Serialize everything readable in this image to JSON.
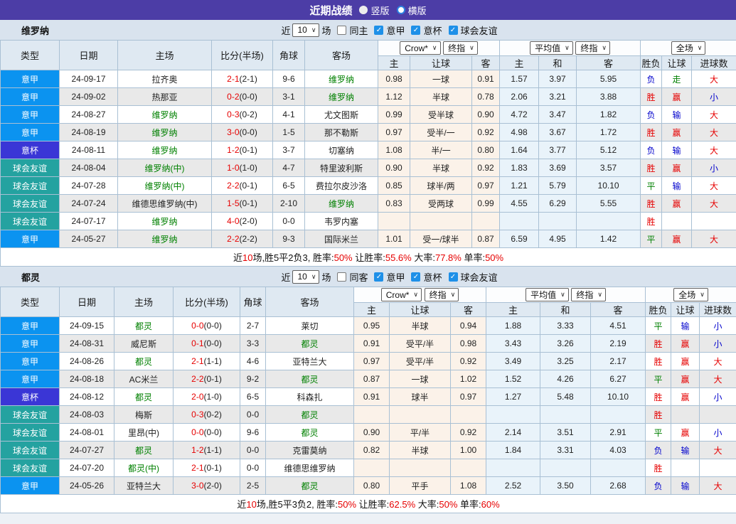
{
  "title_bar": {
    "title": "近期战绩",
    "radio_vertical": "竖版",
    "radio_horizontal": "横版"
  },
  "filters_common": {
    "near_label": "近",
    "matches_count": "10",
    "matches_label": "场",
    "league_seriea": "意甲",
    "league_cup": "意杯",
    "league_friendly": "球会友谊"
  },
  "columns": {
    "type": "类型",
    "date": "日期",
    "home": "主场",
    "score": "比分(半场)",
    "corner": "角球",
    "away": "客场",
    "odds_home": "主",
    "odds_handicap": "让球",
    "odds_away": "客",
    "avg_home": "主",
    "avg_draw": "和",
    "avg_away": "客",
    "result_wl": "胜负",
    "result_handicap": "让球",
    "result_goals": "进球数",
    "bookmaker": "Crow*",
    "final_odds": "终指",
    "average": "平均值",
    "full_match": "全场"
  },
  "sections": [
    {
      "team": "维罗纳",
      "same_filter_label": "同主",
      "rows": [
        {
          "type": "意甲",
          "type_key": "seriea",
          "date": "24-09-17",
          "home": "拉齐奥",
          "home_hl": false,
          "score_ft": "2-1",
          "score_ht": "(2-1)",
          "corner": "9-6",
          "away": "维罗纳",
          "away_hl": true,
          "o1": "0.98",
          "hc": "一球",
          "o2": "0.91",
          "a1": "1.57",
          "a2": "3.97",
          "a3": "5.95",
          "r1": "负",
          "r2": "走",
          "r3": "大"
        },
        {
          "type": "意甲",
          "type_key": "seriea",
          "date": "24-09-02",
          "home": "热那亚",
          "home_hl": false,
          "score_ft": "0-2",
          "score_ht": "(0-0)",
          "corner": "3-1",
          "away": "维罗纳",
          "away_hl": true,
          "o1": "1.12",
          "hc": "半球",
          "o2": "0.78",
          "a1": "2.06",
          "a2": "3.21",
          "a3": "3.88",
          "r1": "胜",
          "r2": "赢",
          "r3": "小"
        },
        {
          "type": "意甲",
          "type_key": "seriea",
          "date": "24-08-27",
          "home": "维罗纳",
          "home_hl": true,
          "score_ft": "0-3",
          "score_ht": "(0-2)",
          "corner": "4-1",
          "away": "尤文图斯",
          "away_hl": false,
          "o1": "0.99",
          "hc": "受半球",
          "o2": "0.90",
          "a1": "4.72",
          "a2": "3.47",
          "a3": "1.82",
          "r1": "负",
          "r2": "输",
          "r3": "大"
        },
        {
          "type": "意甲",
          "type_key": "seriea",
          "date": "24-08-19",
          "home": "维罗纳",
          "home_hl": true,
          "score_ft": "3-0",
          "score_ht": "(0-0)",
          "corner": "1-5",
          "away": "那不勒斯",
          "away_hl": false,
          "o1": "0.97",
          "hc": "受半/一",
          "o2": "0.92",
          "a1": "4.98",
          "a2": "3.67",
          "a3": "1.72",
          "r1": "胜",
          "r2": "赢",
          "r3": "大"
        },
        {
          "type": "意杯",
          "type_key": "cup",
          "date": "24-08-11",
          "home": "维罗纳",
          "home_hl": true,
          "score_ft": "1-2",
          "score_ht": "(0-1)",
          "corner": "3-7",
          "away": "切塞纳",
          "away_hl": false,
          "o1": "1.08",
          "hc": "半/一",
          "o2": "0.80",
          "a1": "1.64",
          "a2": "3.77",
          "a3": "5.12",
          "r1": "负",
          "r2": "输",
          "r3": "大"
        },
        {
          "type": "球会友谊",
          "type_key": "friendly",
          "date": "24-08-04",
          "home": "维罗纳(中)",
          "home_hl": true,
          "score_ft": "1-0",
          "score_ht": "(1-0)",
          "corner": "4-7",
          "away": "特里波利斯",
          "away_hl": false,
          "o1": "0.90",
          "hc": "半球",
          "o2": "0.92",
          "a1": "1.83",
          "a2": "3.69",
          "a3": "3.57",
          "r1": "胜",
          "r2": "赢",
          "r3": "小"
        },
        {
          "type": "球会友谊",
          "type_key": "friendly",
          "date": "24-07-28",
          "home": "维罗纳(中)",
          "home_hl": true,
          "score_ft": "2-2",
          "score_ht": "(0-1)",
          "corner": "6-5",
          "away": "费拉尔皮沙洛",
          "away_hl": false,
          "o1": "0.85",
          "hc": "球半/两",
          "o2": "0.97",
          "a1": "1.21",
          "a2": "5.79",
          "a3": "10.10",
          "r1": "平",
          "r2": "输",
          "r3": "大"
        },
        {
          "type": "球会友谊",
          "type_key": "friendly",
          "date": "24-07-24",
          "home": "维德思维罗纳(中)",
          "home_hl": false,
          "score_ft": "1-5",
          "score_ht": "(0-1)",
          "corner": "2-10",
          "away": "维罗纳",
          "away_hl": true,
          "o1": "0.83",
          "hc": "受两球",
          "o2": "0.99",
          "a1": "4.55",
          "a2": "6.29",
          "a3": "5.55",
          "r1": "胜",
          "r2": "赢",
          "r3": "大"
        },
        {
          "type": "球会友谊",
          "type_key": "friendly",
          "date": "24-07-17",
          "home": "维罗纳",
          "home_hl": true,
          "score_ft": "4-0",
          "score_ht": "(2-0)",
          "corner": "0-0",
          "away": "韦罗内塞",
          "away_hl": false,
          "o1": "",
          "hc": "",
          "o2": "",
          "a1": "",
          "a2": "",
          "a3": "",
          "r1": "胜",
          "r2": "",
          "r3": ""
        },
        {
          "type": "意甲",
          "type_key": "seriea",
          "date": "24-05-27",
          "home": "维罗纳",
          "home_hl": true,
          "score_ft": "2-2",
          "score_ht": "(2-2)",
          "corner": "9-3",
          "away": "国际米兰",
          "away_hl": false,
          "o1": "1.01",
          "hc": "受一/球半",
          "o2": "0.87",
          "a1": "6.59",
          "a2": "4.95",
          "a3": "1.42",
          "r1": "平",
          "r2": "赢",
          "r3": "大"
        }
      ],
      "summary_segments": [
        [
          "近",
          "k"
        ],
        [
          "10",
          "r"
        ],
        [
          "场,胜5平2负3, ",
          "k"
        ],
        [
          "胜率:",
          "k"
        ],
        [
          "50%",
          "r"
        ],
        [
          " 让胜率:",
          "k"
        ],
        [
          "55.6%",
          "r"
        ],
        [
          " 大率:",
          "k"
        ],
        [
          "77.8%",
          "r"
        ],
        [
          " 单率:",
          "k"
        ],
        [
          "50%",
          "r"
        ]
      ]
    },
    {
      "team": "都灵",
      "same_filter_label": "同客",
      "rows": [
        {
          "type": "意甲",
          "type_key": "seriea",
          "date": "24-09-15",
          "home": "都灵",
          "home_hl": true,
          "score_ft": "0-0",
          "score_ht": "(0-0)",
          "corner": "2-7",
          "away": "莱切",
          "away_hl": false,
          "o1": "0.95",
          "hc": "半球",
          "o2": "0.94",
          "a1": "1.88",
          "a2": "3.33",
          "a3": "4.51",
          "r1": "平",
          "r2": "输",
          "r3": "小"
        },
        {
          "type": "意甲",
          "type_key": "seriea",
          "date": "24-08-31",
          "home": "威尼斯",
          "home_hl": false,
          "score_ft": "0-1",
          "score_ht": "(0-0)",
          "corner": "3-3",
          "away": "都灵",
          "away_hl": true,
          "o1": "0.91",
          "hc": "受平/半",
          "o2": "0.98",
          "a1": "3.43",
          "a2": "3.26",
          "a3": "2.19",
          "r1": "胜",
          "r2": "赢",
          "r3": "小"
        },
        {
          "type": "意甲",
          "type_key": "seriea",
          "date": "24-08-26",
          "home": "都灵",
          "home_hl": true,
          "score_ft": "2-1",
          "score_ht": "(1-1)",
          "corner": "4-6",
          "away": "亚特兰大",
          "away_hl": false,
          "o1": "0.97",
          "hc": "受平/半",
          "o2": "0.92",
          "a1": "3.49",
          "a2": "3.25",
          "a3": "2.17",
          "r1": "胜",
          "r2": "赢",
          "r3": "大"
        },
        {
          "type": "意甲",
          "type_key": "seriea",
          "date": "24-08-18",
          "home": "AC米兰",
          "home_hl": false,
          "score_ft": "2-2",
          "score_ht": "(0-1)",
          "corner": "9-2",
          "away": "都灵",
          "away_hl": true,
          "o1": "0.87",
          "hc": "一球",
          "o2": "1.02",
          "a1": "1.52",
          "a2": "4.26",
          "a3": "6.27",
          "r1": "平",
          "r2": "赢",
          "r3": "大"
        },
        {
          "type": "意杯",
          "type_key": "cup",
          "date": "24-08-12",
          "home": "都灵",
          "home_hl": true,
          "score_ft": "2-0",
          "score_ht": "(1-0)",
          "corner": "6-5",
          "away": "科森扎",
          "away_hl": false,
          "o1": "0.91",
          "hc": "球半",
          "o2": "0.97",
          "a1": "1.27",
          "a2": "5.48",
          "a3": "10.10",
          "r1": "胜",
          "r2": "赢",
          "r3": "小"
        },
        {
          "type": "球会友谊",
          "type_key": "friendly",
          "date": "24-08-03",
          "home": "梅斯",
          "home_hl": false,
          "score_ft": "0-3",
          "score_ht": "(0-2)",
          "corner": "0-0",
          "away": "都灵",
          "away_hl": true,
          "o1": "",
          "hc": "",
          "o2": "",
          "a1": "",
          "a2": "",
          "a3": "",
          "r1": "胜",
          "r2": "",
          "r3": ""
        },
        {
          "type": "球会友谊",
          "type_key": "friendly",
          "date": "24-08-01",
          "home": "里昂(中)",
          "home_hl": false,
          "score_ft": "0-0",
          "score_ht": "(0-0)",
          "corner": "9-6",
          "away": "都灵",
          "away_hl": true,
          "o1": "0.90",
          "hc": "平/半",
          "o2": "0.92",
          "a1": "2.14",
          "a2": "3.51",
          "a3": "2.91",
          "r1": "平",
          "r2": "赢",
          "r3": "小"
        },
        {
          "type": "球会友谊",
          "type_key": "friendly",
          "date": "24-07-27",
          "home": "都灵",
          "home_hl": true,
          "score_ft": "1-2",
          "score_ht": "(1-1)",
          "corner": "0-0",
          "away": "克雷莫纳",
          "away_hl": false,
          "o1": "0.82",
          "hc": "半球",
          "o2": "1.00",
          "a1": "1.84",
          "a2": "3.31",
          "a3": "4.03",
          "r1": "负",
          "r2": "输",
          "r3": "大"
        },
        {
          "type": "球会友谊",
          "type_key": "friendly",
          "date": "24-07-20",
          "home": "都灵(中)",
          "home_hl": true,
          "score_ft": "2-1",
          "score_ht": "(0-1)",
          "corner": "0-0",
          "away": "维德思维罗纳",
          "away_hl": false,
          "o1": "",
          "hc": "",
          "o2": "",
          "a1": "",
          "a2": "",
          "a3": "",
          "r1": "胜",
          "r2": "",
          "r3": ""
        },
        {
          "type": "意甲",
          "type_key": "seriea",
          "date": "24-05-26",
          "home": "亚特兰大",
          "home_hl": false,
          "score_ft": "3-0",
          "score_ht": "(2-0)",
          "corner": "2-5",
          "away": "都灵",
          "away_hl": true,
          "o1": "0.80",
          "hc": "平手",
          "o2": "1.08",
          "a1": "2.52",
          "a2": "3.50",
          "a3": "2.68",
          "r1": "负",
          "r2": "输",
          "r3": "大"
        }
      ],
      "summary_segments": [
        [
          "近",
          "k"
        ],
        [
          "10",
          "r"
        ],
        [
          "场,胜5平3负2, ",
          "k"
        ],
        [
          "胜率:",
          "k"
        ],
        [
          "50%",
          "r"
        ],
        [
          " 让胜率:",
          "k"
        ],
        [
          "62.5%",
          "r"
        ],
        [
          " 大率:",
          "k"
        ],
        [
          "50%",
          "r"
        ],
        [
          " 单率:",
          "k"
        ],
        [
          "60%",
          "r"
        ]
      ]
    }
  ],
  "colors": {
    "titlebar": "#4c3da6",
    "seriea": "#0b93f0",
    "cup": "#3a36d6",
    "friendly": "#24a2a0",
    "win_red": "#e60000",
    "lose_blue": "#0000cc",
    "draw_green": "#008000"
  }
}
